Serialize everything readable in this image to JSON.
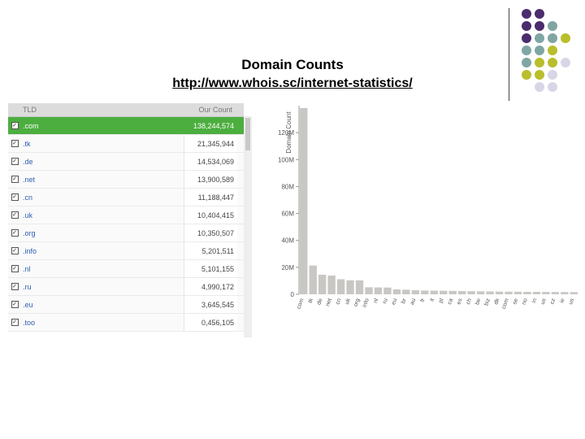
{
  "slide": {
    "title": "Domain Counts",
    "link": "http://www.whois.sc/internet-statistics/"
  },
  "table": {
    "header_tld": "TLD",
    "header_count": "Our Count",
    "rows": [
      {
        "tld": ".com",
        "count": "138,244,574"
      },
      {
        "tld": ".tk",
        "count": "21,345,944"
      },
      {
        "tld": ".de",
        "count": "14,534,069"
      },
      {
        "tld": ".net",
        "count": "13,900,589"
      },
      {
        "tld": ".cn",
        "count": "11,188,447"
      },
      {
        "tld": ".uk",
        "count": "10,404,415"
      },
      {
        "tld": ".org",
        "count": "10,350,507"
      },
      {
        "tld": ".info",
        "count": "5,201,511"
      },
      {
        "tld": ".nl",
        "count": "5,101,155"
      },
      {
        "tld": ".ru",
        "count": "4,990,172"
      },
      {
        "tld": ".eu",
        "count": "3,645,545"
      },
      {
        "tld": ".too",
        "count": "0,456,105"
      }
    ]
  },
  "colors": {
    "selected_row": "#4cae3f",
    "bar": "#c9c7c4",
    "dot_purple": "#4b2c6e",
    "dot_teal": "#7fa6a3",
    "dot_olive": "#b9be2c",
    "dot_lavender": "#d8d6e6"
  },
  "chart_data": {
    "type": "bar",
    "ylabel": "Domain Count",
    "ylim": [
      0,
      140000000
    ],
    "yticks": [
      0,
      20000000,
      40000000,
      60000000,
      80000000,
      100000000,
      120000000
    ],
    "ytick_labels": [
      "0",
      "20M",
      "40M",
      "60M",
      "80M",
      "100M",
      "120M"
    ],
    "categories": [
      "com",
      "tk",
      "de",
      "net",
      "cn",
      "uk",
      "org",
      "info",
      "nl",
      "ru",
      "eu",
      "br",
      "au",
      "fr",
      "it",
      "pl",
      "ca",
      "es",
      "ch",
      "be",
      "biz",
      "dk",
      "com",
      "se",
      "no",
      "in",
      "us",
      "cz",
      "ie",
      "us"
    ],
    "values": [
      138244574,
      21345944,
      14534069,
      13900589,
      11188447,
      10404415,
      10350507,
      5201511,
      5101155,
      4990172,
      3645545,
      3400000,
      3000000,
      2800000,
      2700000,
      2600000,
      2500000,
      2400000,
      2300000,
      2200000,
      2100000,
      2000000,
      1950000,
      1900000,
      1850000,
      1800000,
      1750000,
      1700000,
      1650000,
      1600000
    ],
    "grid": false
  }
}
